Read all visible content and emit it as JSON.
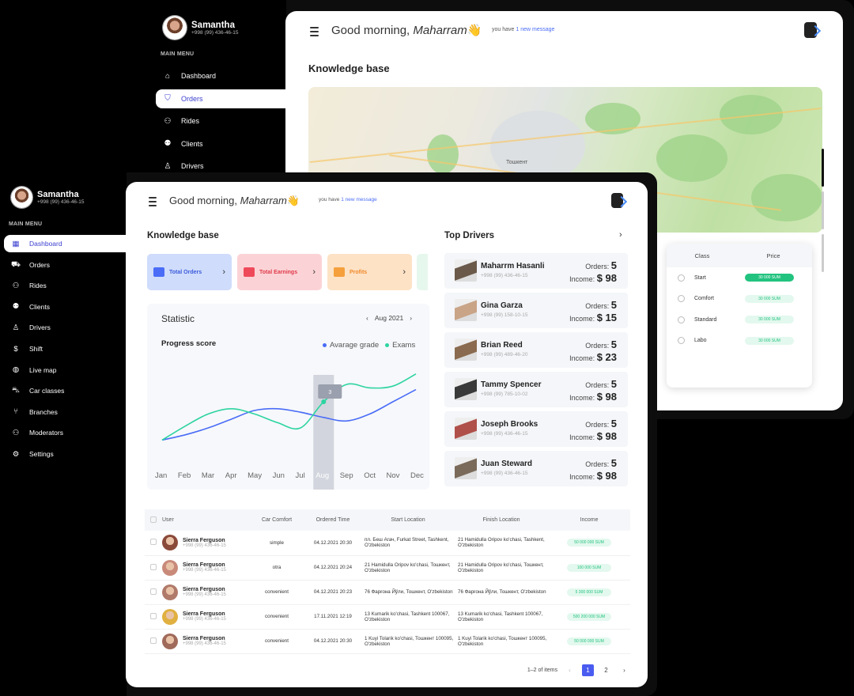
{
  "back": {
    "profile": {
      "name": "Samantha",
      "phone": "+998 (99) 436-46-15"
    },
    "menu_header": "MAIN MENU",
    "menu": [
      {
        "label": "Dashboard",
        "icon": "home-icon"
      },
      {
        "label": "Orders",
        "icon": "bookmark-icon",
        "active": true
      },
      {
        "label": "Rides",
        "icon": "rides-icon"
      },
      {
        "label": "Clients",
        "icon": "clients-icon"
      },
      {
        "label": "Drivers",
        "icon": "driver-icon"
      }
    ],
    "greeting": "Good morning,",
    "greeting_name": "Maharram",
    "wave": "👋",
    "msg_prefix": "you have",
    "msg_link": "1 new message",
    "section_title": "Knowledge base",
    "map_label": "Тошкент",
    "price_table": {
      "headers": [
        "Class",
        "Price"
      ],
      "rows": [
        {
          "cls": "Start",
          "price": "30 000 SUM",
          "selected": true
        },
        {
          "cls": "Comfort",
          "price": "30 000 SUM"
        },
        {
          "cls": "Standard",
          "price": "30 000 SUM"
        },
        {
          "cls": "Labo",
          "price": "30 000 SUM"
        }
      ]
    }
  },
  "front": {
    "profile": {
      "name": "Samantha",
      "phone": "+998 (99) 436-46-15"
    },
    "menu_header": "MAIN MENU",
    "menu": [
      {
        "label": "Dashboard",
        "icon": "dashboard-icon",
        "active": true
      },
      {
        "label": "Orders",
        "icon": "orders-icon"
      },
      {
        "label": "Rides",
        "icon": "rides-icon"
      },
      {
        "label": "Clients",
        "icon": "clients-icon"
      },
      {
        "label": "Drivers",
        "icon": "driver-icon"
      },
      {
        "label": "Shift",
        "icon": "dollar-icon"
      },
      {
        "label": "Live map",
        "icon": "globe-icon"
      },
      {
        "label": "Car classes",
        "icon": "car-icon"
      },
      {
        "label": "Branches",
        "icon": "branch-icon"
      },
      {
        "label": "Moderators",
        "icon": "moderators-icon"
      },
      {
        "label": "Settings",
        "icon": "settings-icon"
      }
    ],
    "greeting": "Good morning,",
    "greeting_name": "Maharram",
    "wave": "👋",
    "msg_prefix": "you have",
    "msg_link": "1 new message",
    "kb_title": "Knowledge base",
    "kb_cards": [
      {
        "label": "Total Orders",
        "bg": "#cfdcfb",
        "fg": "#3b5bdb",
        "icon": "#4a6cf7"
      },
      {
        "label": "Total Earnings",
        "bg": "#fbd3d6",
        "fg": "#e03a4a",
        "icon": "#ef4a5a"
      },
      {
        "label": "Profits",
        "bg": "#fde2c6",
        "fg": "#f08a2a",
        "icon": "#f5a03c"
      }
    ],
    "statistic": {
      "title": "Statistic",
      "period": "Aug 2021",
      "subtitle": "Progress score",
      "tooltip": "3",
      "chart_data": {
        "type": "line",
        "x": [
          "Jan",
          "Feb",
          "Mar",
          "Apr",
          "May",
          "Jun",
          "Jul",
          "Aug",
          "Sep",
          "Oct",
          "Nov",
          "Dec"
        ],
        "series": [
          {
            "name": "Avarage grade",
            "color": "#4a6cf7",
            "values": [
              1.8,
              2.1,
              2.5,
              3.0,
              3.5,
              3.6,
              3.4,
              3.1,
              2.9,
              3.3,
              4.0,
              4.7
            ]
          },
          {
            "name": "Exams",
            "color": "#2dd4a0",
            "values": [
              1.8,
              2.6,
              3.3,
              3.6,
              3.3,
              2.8,
              2.5,
              4.0,
              5.0,
              4.8,
              4.9,
              5.6
            ]
          }
        ],
        "highlight": "Aug"
      }
    },
    "top_drivers": {
      "title": "Top Drivers",
      "orders_label": "Orders:",
      "income_label": "Income:",
      "drivers": [
        {
          "name": "Maharrm Hasanli",
          "phone": "+998 (99) 436-46-15",
          "orders": "5",
          "income": "$ 98",
          "tone": "#6b5a4a"
        },
        {
          "name": "Gina Garza",
          "phone": "+998 (99) 158-10-15",
          "orders": "5",
          "income": "$ 15",
          "tone": "#c9a487"
        },
        {
          "name": "Brian Reed",
          "phone": "+998 (99) 489-46-20",
          "orders": "5",
          "income": "$ 23",
          "tone": "#8a6b4f"
        },
        {
          "name": "Tammy Spencer",
          "phone": "+998 (99) 785-10-02",
          "orders": "5",
          "income": "$ 98",
          "tone": "#3a3a3a"
        },
        {
          "name": "Joseph Brooks",
          "phone": "+998 (99) 436-46-15",
          "orders": "5",
          "income": "$ 98",
          "tone": "#b0504a"
        },
        {
          "name": "Juan Steward",
          "phone": "+998 (99) 436-46-15",
          "orders": "5",
          "income": "$ 98",
          "tone": "#7a6a5a"
        }
      ]
    },
    "table": {
      "headers": [
        "User",
        "Car Comfort",
        "Ordered Time",
        "Start Location",
        "Finish Location",
        "Income"
      ],
      "rows": [
        {
          "name": "Sierra Ferguson",
          "phone": "+998 (99) 436-46-15",
          "comfort": "simple",
          "time": "04.12.2021 20:30",
          "start": "пл. Беш Агач, Furkat Street, Tashkent, O'zbekiston",
          "finish": "21 Hamidulla Oripov ko'chasi, Tashkent, O'zbekiston",
          "income": "50 000 000 SUM",
          "tone": "#8a4a3a"
        },
        {
          "name": "Sierra Ferguson",
          "phone": "+998 (99) 436-46-15",
          "comfort": "otra",
          "time": "04.12.2021 20:24",
          "start": "21 Hamidulla Oripov ko'chasi, Тошкент, O'zbekiston",
          "finish": "21 Hamidulla Oripov ko'chasi, Тошкент, O'zbekiston",
          "income": "100 000 SUM",
          "tone": "#c98a7a"
        },
        {
          "name": "Sierra Ferguson",
          "phone": "+998 (99) 436-46-15",
          "comfort": "convenient",
          "time": "04.12.2021 20:23",
          "start": "76 Фарғона Йўли, Тошкент, O'zbekiston",
          "finish": "76 Фарғона Йўли, Тошкент, O'zbekiston",
          "income": "5 300 000 SUM",
          "tone": "#b07a6a"
        },
        {
          "name": "Sierra Ferguson",
          "phone": "+998 (99) 436-46-15",
          "comfort": "convenient",
          "time": "17.11.2021 12:19",
          "start": "13 Kumarik ko'chasi, Tashkent 100067, O'zbekiston",
          "finish": "13 Kumarik ko'chasi, Tashkent 100067, O'zbekiston",
          "income": "500 200 000 SUM",
          "tone": "#e0b040"
        },
        {
          "name": "Sierra Ferguson",
          "phone": "+998 (99) 436-46-15",
          "comfort": "convenient",
          "time": "04.12.2021 20:30",
          "start": "1 Kuyi Tolarik ko'chasi, Тошкент 100095, O'zbekiston",
          "finish": "1 Kuyi Tolarik ko'chasi, Тошкент 100095, O'zbekiston",
          "income": "50 000 000 SUM",
          "tone": "#a06a5a"
        }
      ]
    },
    "pagination": {
      "summary": "1–2 of items",
      "pages": [
        "1",
        "2"
      ],
      "current": "1"
    }
  }
}
